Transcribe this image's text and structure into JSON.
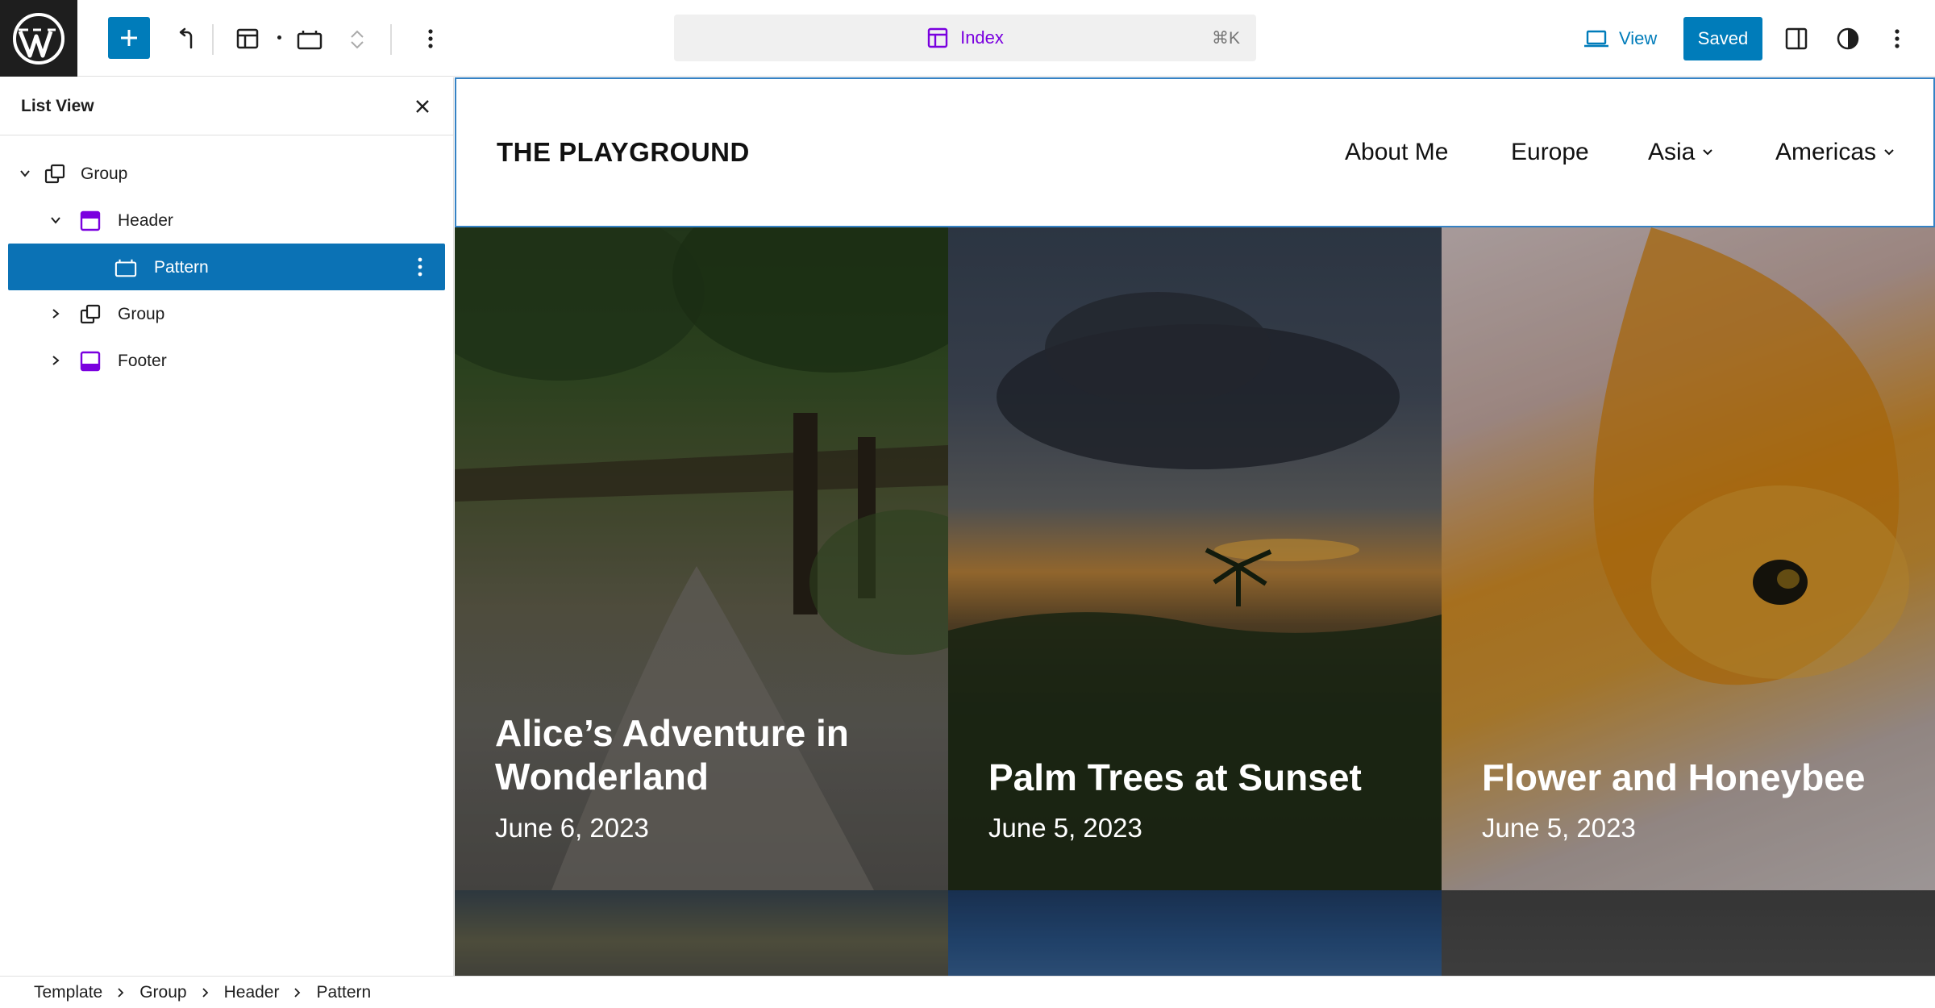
{
  "toolbar": {
    "document_title": "Index",
    "shortcut": "⌘K",
    "view_label": "View",
    "saved_label": "Saved"
  },
  "colors": {
    "accent": "#007cba",
    "selected_row": "#0b72b5",
    "template_purple": "#7a00df"
  },
  "list_view": {
    "title": "List View",
    "items": [
      {
        "label": "Group",
        "icon": "group-icon",
        "level": 0,
        "expanded": true
      },
      {
        "label": "Header",
        "icon": "template-part-icon",
        "level": 1,
        "expanded": true
      },
      {
        "label": "Pattern",
        "icon": "pattern-icon",
        "level": 2,
        "selected": true
      },
      {
        "label": "Group",
        "icon": "group-icon",
        "level": 1,
        "expanded": false
      },
      {
        "label": "Footer",
        "icon": "footer-icon",
        "level": 1,
        "expanded": false
      }
    ]
  },
  "site": {
    "title": "THE PLAYGROUND",
    "nav": [
      {
        "label": "About Me",
        "has_submenu": false
      },
      {
        "label": "Europe",
        "has_submenu": false
      },
      {
        "label": "Asia",
        "has_submenu": true
      },
      {
        "label": "Americas",
        "has_submenu": true
      }
    ]
  },
  "posts": [
    {
      "title": "Alice’s Adventure in Wonderland",
      "date": "June 6, 2023"
    },
    {
      "title": "Palm Trees at Sunset",
      "date": "June 5, 2023"
    },
    {
      "title": "Flower and Honeybee",
      "date": "June 5, 2023"
    }
  ],
  "breadcrumb": [
    "Template",
    "Group",
    "Header",
    "Pattern"
  ]
}
